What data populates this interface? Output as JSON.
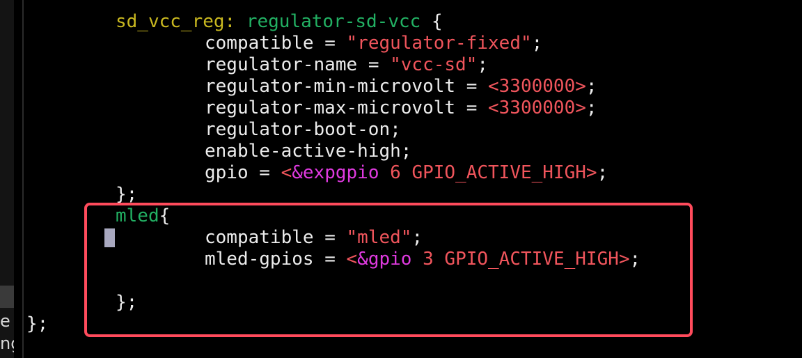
{
  "sidebar": {
    "fragment_top": "e",
    "fragment_bottom": "ng"
  },
  "code": {
    "l1": {
      "label": "sd_vcc_reg:",
      "node": "regulator-sd-vcc",
      "brace": "{"
    },
    "l2": {
      "prop": "compatible",
      "eq": "=",
      "value": "\"regulator-fixed\"",
      "end": ";"
    },
    "l3": {
      "prop": "regulator-name",
      "eq": "=",
      "value": "\"vcc-sd\"",
      "end": ";"
    },
    "l4": {
      "prop": "regulator-min-microvolt",
      "eq": "=",
      "value": "<3300000>",
      "end": ";"
    },
    "l5": {
      "prop": "regulator-max-microvolt",
      "eq": "=",
      "value": "<3300000>",
      "end": ";"
    },
    "l6": {
      "prop": "regulator-boot-on;"
    },
    "l7": {
      "prop": "enable-active-high;"
    },
    "l8": {
      "prop": "gpio",
      "eq": "=",
      "open": "<",
      "ref": "&expgpio",
      "args": "6 GPIO_ACTIVE_HIGH>",
      "end": ";"
    },
    "l9": {
      "close": "};"
    },
    "l10": {
      "node": "mled",
      "brace": "{"
    },
    "l11": {
      "prop": "compatible",
      "eq": "=",
      "value": "\"mled\"",
      "end": ";"
    },
    "l12": {
      "prop": "mled-gpios",
      "eq": "=",
      "open": "<",
      "ref": "&gpio",
      "args": "3 GPIO_ACTIVE_HIGH>",
      "end": ";"
    },
    "l13": {
      "close": "};"
    },
    "l14": {
      "close": "};"
    }
  },
  "colors": {
    "background": "#000000",
    "label": "#c9b820",
    "node": "#22b063",
    "string_number": "#f0555c",
    "reference": "#e03ae0",
    "highlight_box": "#ff4b5c"
  }
}
